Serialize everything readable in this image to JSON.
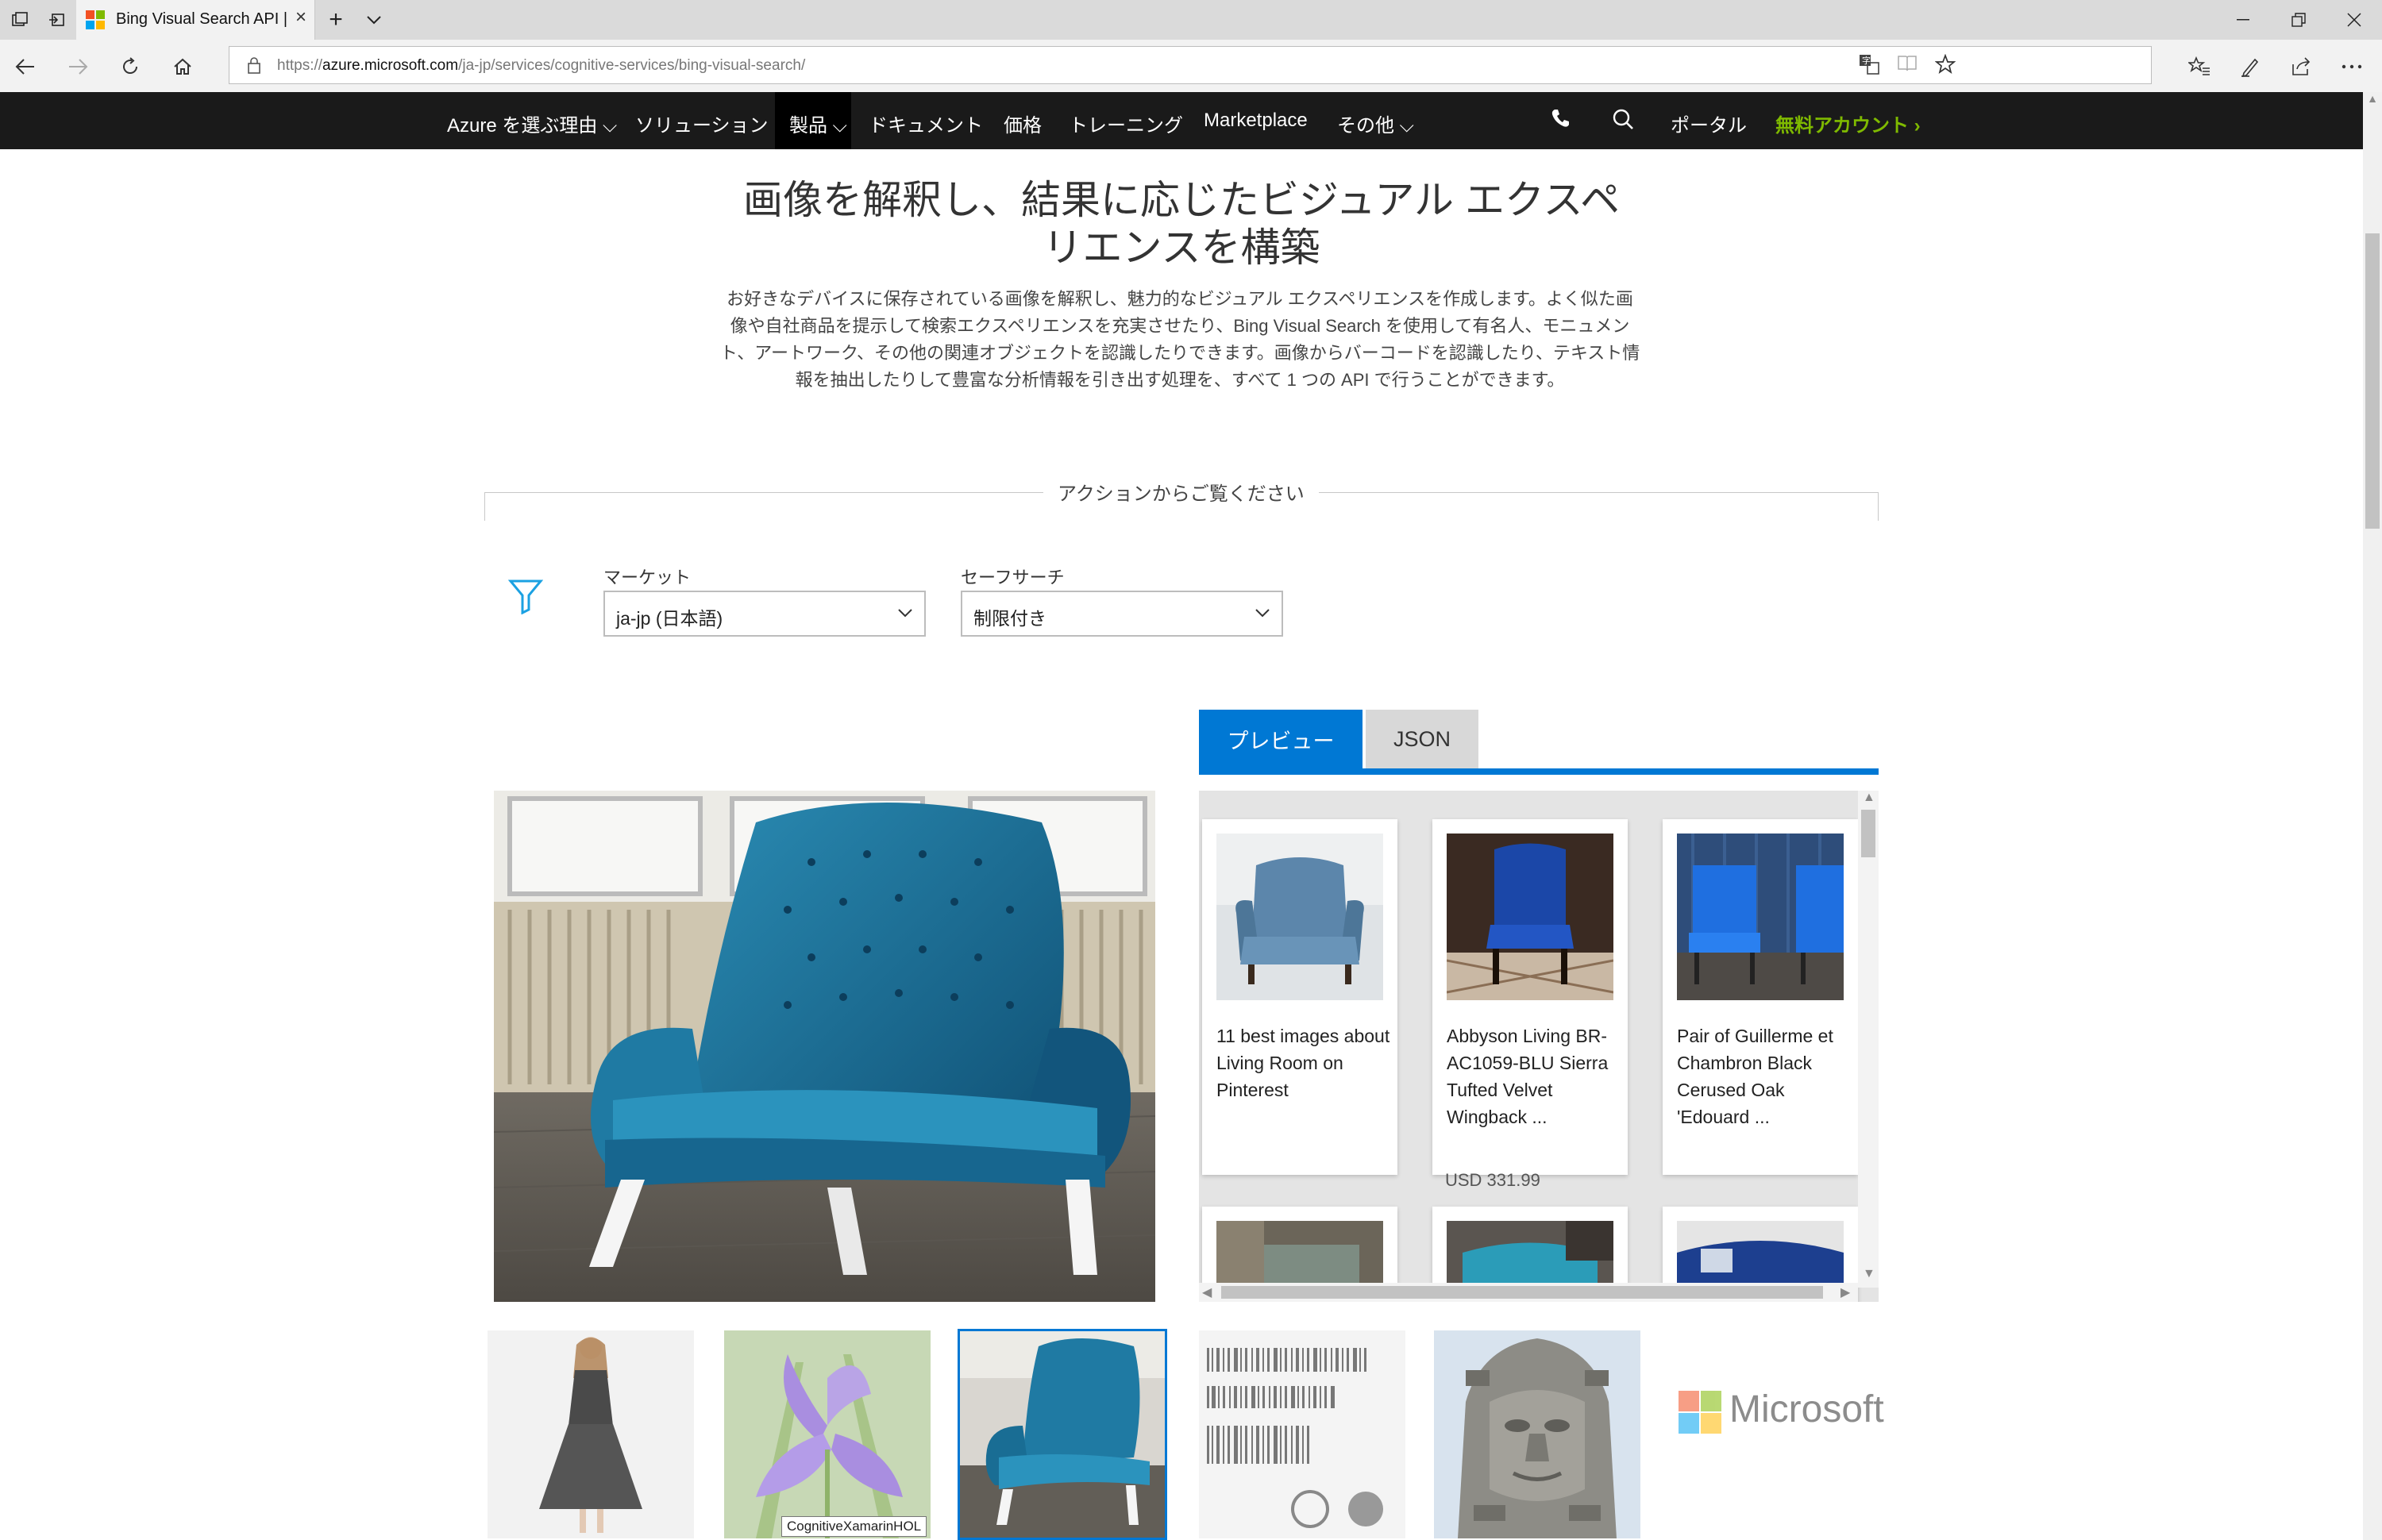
{
  "browser": {
    "tab_title": "Bing Visual Search API |",
    "url_prefix": "https://",
    "url_host": "azure.microsoft.com",
    "url_path": "/ja-jp/services/cognitive-services/bing-visual-search/"
  },
  "site_nav": {
    "items": [
      "Azure を選ぶ理由",
      "ソリューション",
      "製品",
      "ドキュメント",
      "価格",
      "トレーニング",
      "Marketplace",
      "その他"
    ],
    "portal": "ポータル",
    "free_account": "無料アカウント"
  },
  "hero": {
    "title_line1": "画像を解釈し、結果に応じたビジュアル エクスペ",
    "title_line2": "リエンスを構築",
    "description": "お好きなデバイスに保存されている画像を解釈し、魅力的なビジュアル エクスペリエンスを作成します。よく似た画像や自社商品を提示して検索エクスペリエンスを充実させたり、Bing Visual Search を使用して有名人、モニュメント、アートワーク、その他の関連オブジェクトを認識したりできます。画像からバーコードを認識したり、テキスト情報を抽出したりして豊富な分析情報を引き出す処理を、すべて 1 つの API で行うことができます。"
  },
  "demo": {
    "section_title": "アクションからご覧ください",
    "market_label": "マーケット",
    "market_value": "ja-jp (日本語)",
    "safesearch_label": "セーフサーチ",
    "safesearch_value": "制限付き",
    "tabs": [
      "プレビュー",
      "JSON"
    ],
    "results": [
      {
        "title": "11 best images about Living Room on Pinterest"
      },
      {
        "title": "Abbyson Living BR-AC1059-BLU Sierra Tufted Velvet Wingback ...",
        "price": "USD 331.99"
      },
      {
        "title": "Pair of Guillerme et Chambron Black Cerused Oak 'Edouard ..."
      }
    ],
    "tooltip": "CognitiveXamarinHOL",
    "logo_text": "Microsoft"
  },
  "colors": {
    "accent": "#0078d4",
    "nav_bg": "#1a1a1a",
    "account_green": "#7fba00"
  }
}
